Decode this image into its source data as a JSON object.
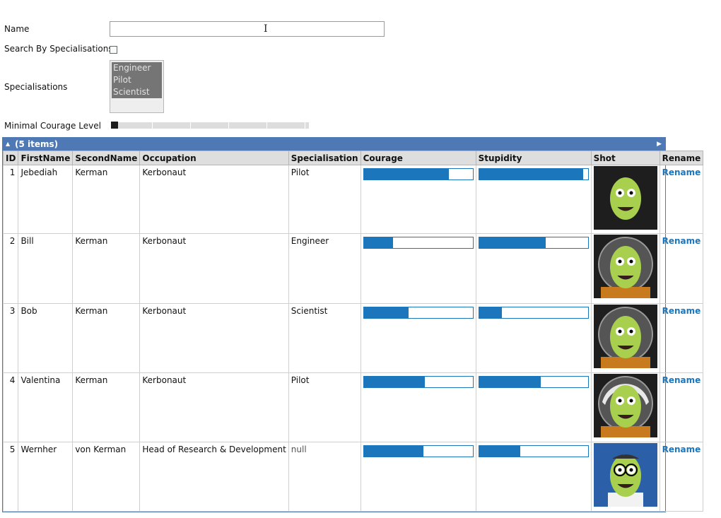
{
  "filters": {
    "name_label": "Name",
    "name_value": "",
    "search_by_spec_label": "Search By Specialisations",
    "search_by_spec_checked": false,
    "specialisations_label": "Specialisations",
    "specialisation_options": [
      "Engineer",
      "Pilot",
      "Scientist"
    ],
    "courage_label": "Minimal Courage Level",
    "courage_value": 0
  },
  "grid": {
    "group_label": "(5 items)",
    "columns": [
      "ID",
      "FirstName",
      "SecondName",
      "Occupation",
      "Specialisation",
      "Courage",
      "Stupidity",
      "Shot",
      "Rename"
    ],
    "rows": [
      {
        "id": "1",
        "first": "Jebediah",
        "second": "Kerman",
        "occupation": "Kerbonaut",
        "spec": "Pilot",
        "courage": 0.78,
        "stupidity": 0.96,
        "rename": "Rename",
        "shot": "jebediah-portrait"
      },
      {
        "id": "2",
        "first": "Bill",
        "second": "Kerman",
        "occupation": "Kerbonaut",
        "spec": "Engineer",
        "courage": 0.27,
        "stupidity": 0.61,
        "rename": "Rename",
        "shot": "bill-portrait"
      },
      {
        "id": "3",
        "first": "Bob",
        "second": "Kerman",
        "occupation": "Kerbonaut",
        "spec": "Scientist",
        "courage": 0.41,
        "stupidity": 0.21,
        "rename": "Rename",
        "shot": "bob-portrait"
      },
      {
        "id": "4",
        "first": "Valentina",
        "second": "Kerman",
        "occupation": "Kerbonaut",
        "spec": "Pilot",
        "courage": 0.56,
        "stupidity": 0.57,
        "rename": "Rename",
        "shot": "valentina-portrait"
      },
      {
        "id": "5",
        "first": "Wernher",
        "second": "von Kerman",
        "occupation": "Head of Research & Development",
        "spec": "null",
        "courage": 0.55,
        "stupidity": 0.38,
        "rename": "Rename",
        "shot": "wernher-portrait"
      }
    ]
  },
  "colors": {
    "accent": "#1b76bb",
    "group_bar": "#4f79b5",
    "selection": "#757575",
    "kerbal_skin": "#a8cf4e"
  }
}
